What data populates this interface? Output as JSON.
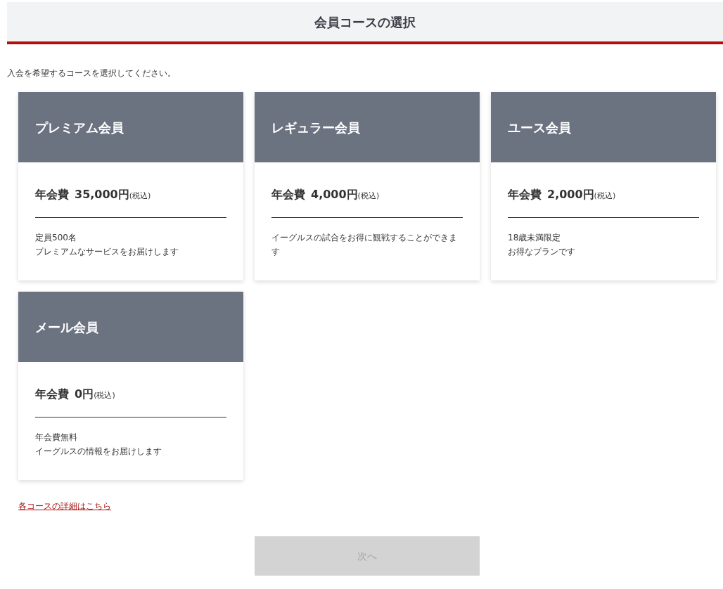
{
  "title": "会員コースの選択",
  "intro": "入会を希望するコースを選択してください。",
  "courses": [
    {
      "name": "プレミアム会員",
      "fee_label": "年会費",
      "amount": "35,000円",
      "tax_note": "(税込)",
      "description": [
        "定員500名",
        "プレミアムなサービスをお届けします"
      ],
      "selected": false
    },
    {
      "name": "レギュラー会員",
      "fee_label": "年会費",
      "amount": "4,000円",
      "tax_note": "(税込)",
      "description": [
        "イーグルスの試合をお得に観戦することができます"
      ],
      "selected": false
    },
    {
      "name": "ユース会員",
      "fee_label": "年会費",
      "amount": "2,000円",
      "tax_note": "(税込)",
      "description": [
        "18歳未満限定",
        "お得なプランです"
      ],
      "selected": false
    },
    {
      "name": "メール会員",
      "fee_label": "年会費",
      "amount": "0円",
      "tax_note": "(税込)",
      "description": [
        "年会費無料",
        "イーグルスの情報をお届けします"
      ],
      "selected": false
    }
  ],
  "details_link": "各コースの詳細はこちら",
  "next_button": {
    "label": "次へ",
    "disabled": true
  }
}
